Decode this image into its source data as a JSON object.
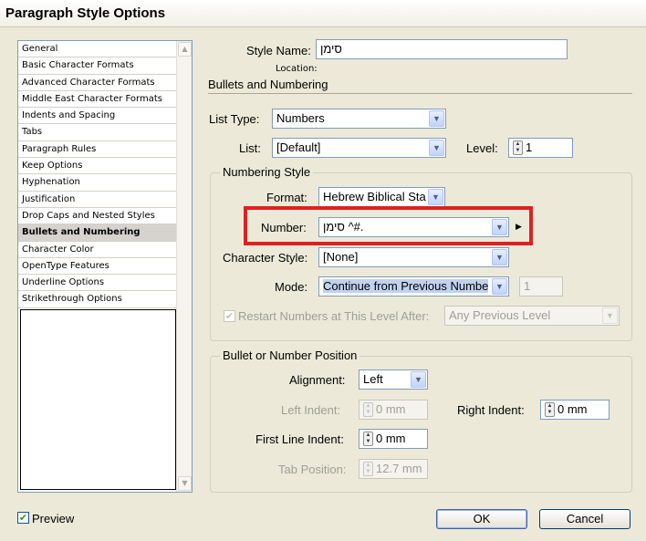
{
  "window": {
    "title": "Paragraph Style Options"
  },
  "sidebar": {
    "items": [
      "General",
      "Basic Character Formats",
      "Advanced Character Formats",
      "Middle East Character Formats",
      "Indents and Spacing",
      "Tabs",
      "Paragraph Rules",
      "Keep Options",
      "Hyphenation",
      "Justification",
      "Drop Caps and Nested Styles",
      "Bullets and Numbering",
      "Character Color",
      "OpenType Features",
      "Underline Options",
      "Strikethrough Options"
    ],
    "selected_index": 11
  },
  "style_name": {
    "label": "Style Name:",
    "value": "סימן"
  },
  "location": {
    "label": "Location:"
  },
  "section_title": "Bullets and Numbering",
  "list_type": {
    "label": "List Type:",
    "value": "Numbers"
  },
  "list": {
    "label": "List:",
    "value": "[Default]"
  },
  "level": {
    "label": "Level:",
    "value": "1"
  },
  "numbering_style": {
    "title": "Numbering Style",
    "format_label": "Format:",
    "format_value": "Hebrew Biblical Sta",
    "number_label": "Number:",
    "number_value": "סימן ^#.",
    "char_style_label": "Character Style:",
    "char_style_value": "[None]",
    "mode_label": "Mode:",
    "mode_value": "Continue from Previous Numbe",
    "mode_start": "1",
    "restart_label": "Restart Numbers at This Level After:",
    "restart_value": "Any Previous Level"
  },
  "position": {
    "title": "Bullet or Number Position",
    "alignment_label": "Alignment:",
    "alignment_value": "Left",
    "left_indent_label": "Left Indent:",
    "left_indent_value": "0 mm",
    "right_indent_label": "Right Indent:",
    "right_indent_value": "0 mm",
    "first_line_label": "First Line Indent:",
    "first_line_value": "0 mm",
    "tab_position_label": "Tab Position:",
    "tab_position_value": "12.7 mm"
  },
  "footer": {
    "preview_label": "Preview",
    "ok_label": "OK",
    "cancel_label": "Cancel"
  },
  "colors": {
    "highlight": "#e02020",
    "selected_item": "#d6d3ce",
    "dialog_bg": "#ece9d8"
  },
  "icons": [
    "checkmark-icon",
    "spinner-icon",
    "dropdown-arrow-icon",
    "flyout-arrow-icon"
  ]
}
